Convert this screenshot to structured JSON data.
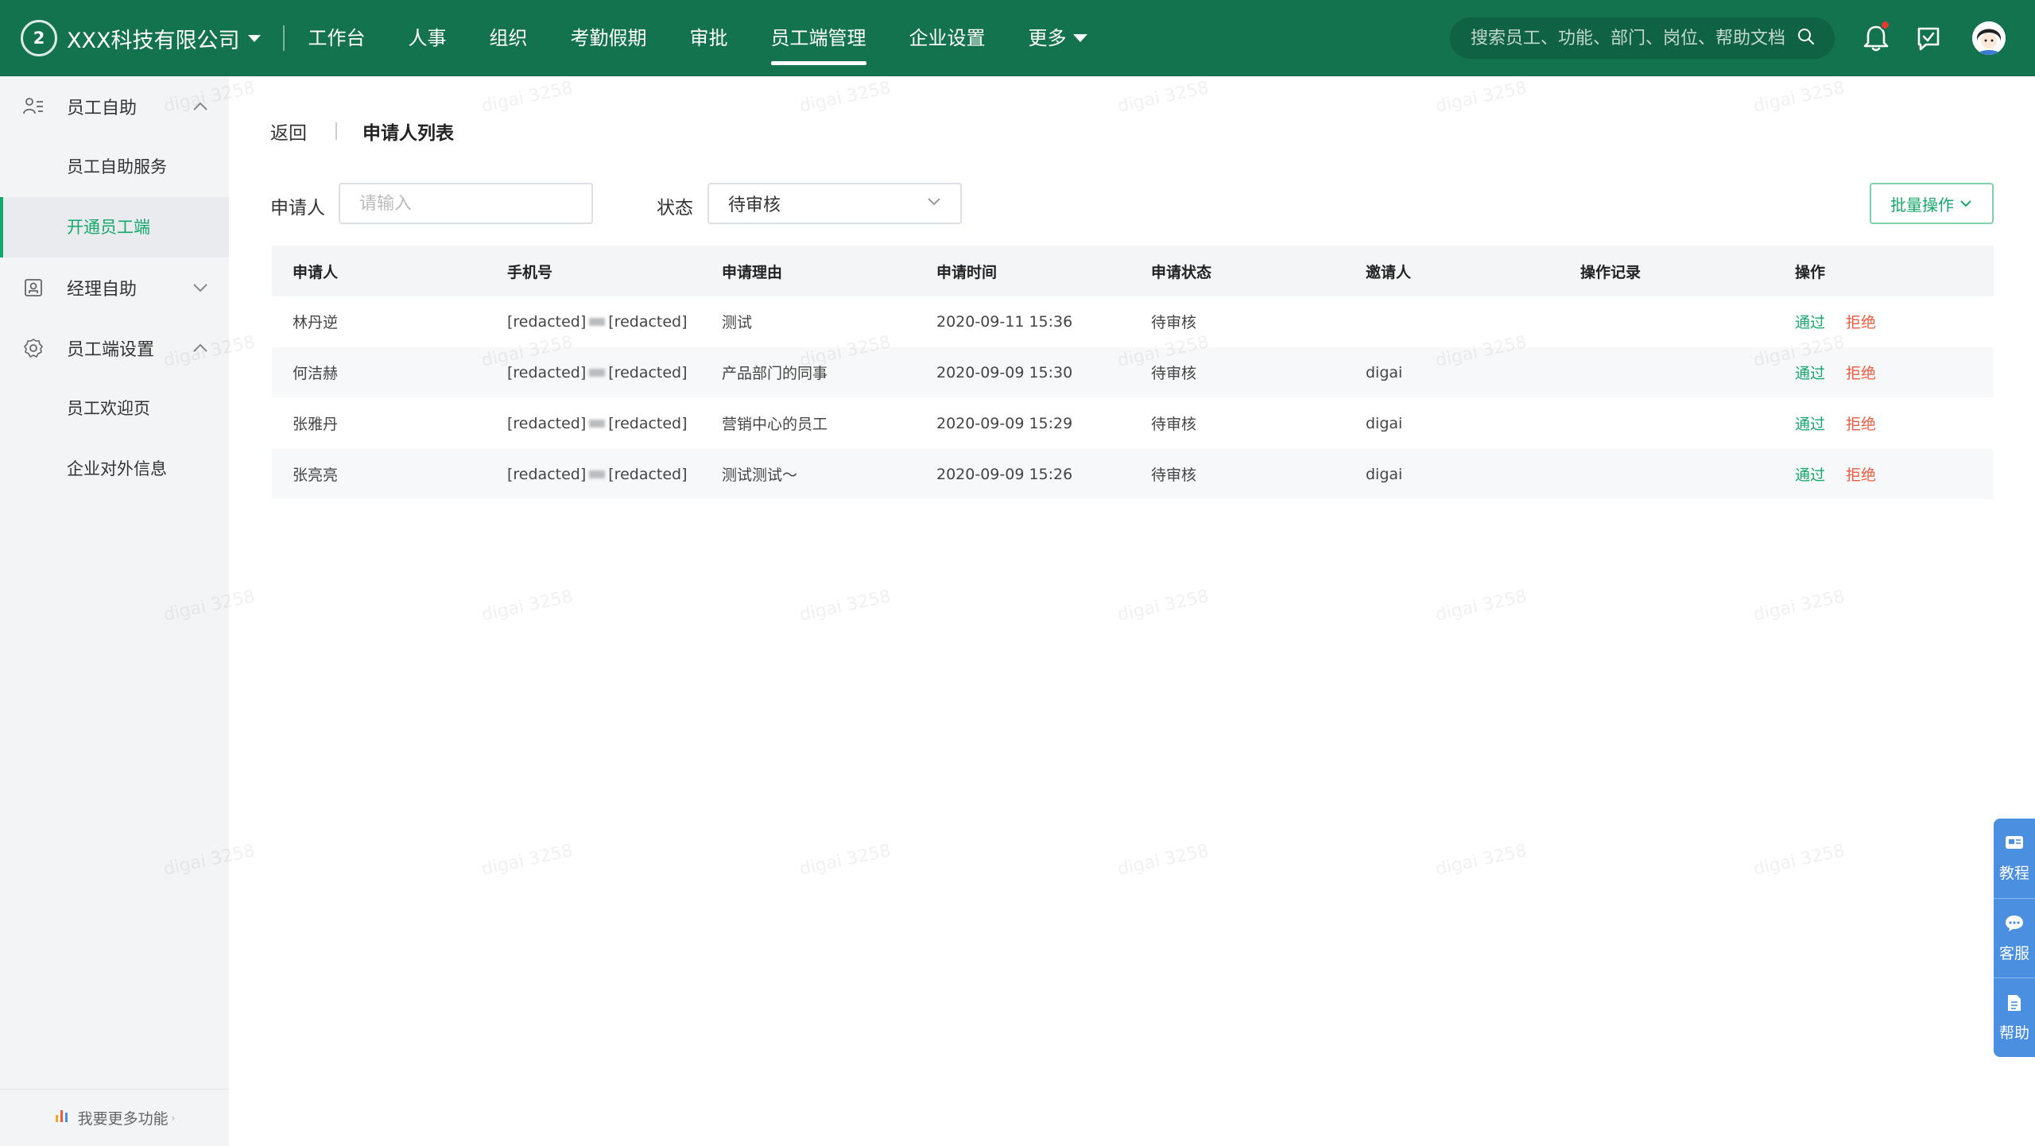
{
  "app": {
    "logo_text": "2",
    "company": "XXX科技有限公司"
  },
  "nav": {
    "items": [
      "工作台",
      "人事",
      "组织",
      "考勤假期",
      "审批",
      "员工端管理",
      "企业设置",
      "更多"
    ],
    "active_index": 5
  },
  "search": {
    "placeholder": "搜索员工、功能、部门、岗位、帮助文档"
  },
  "sidebar": {
    "groups": [
      {
        "label": "员工自助",
        "icon": "person-list-icon",
        "expanded": true
      },
      {
        "label": "经理自助",
        "icon": "badge-icon",
        "expanded": false
      },
      {
        "label": "员工端设置",
        "icon": "gear-icon",
        "expanded": true
      }
    ],
    "subitems": [
      "员工自助服务",
      "开通员工端",
      "员工欢迎页",
      "企业对外信息"
    ],
    "active_subitem": "开通员工端",
    "more_functions": "我要更多功能"
  },
  "breadcrumb": {
    "back": "返回",
    "title": "申请人列表"
  },
  "filters": {
    "applicant_label": "申请人",
    "applicant_placeholder": "请输入",
    "status_label": "状态",
    "status_value": "待审核"
  },
  "batch_button": "批量操作",
  "table": {
    "headers": [
      "申请人",
      "手机号",
      "申请理由",
      "申请时间",
      "申请状态",
      "邀请人",
      "操作记录",
      "操作"
    ],
    "rows": [
      {
        "name": "林丹逆",
        "phone_prefix": "[redacted]",
        "phone_suffix": "[redacted]",
        "reason": "测试",
        "time": "2020-09-11 15:36",
        "status": "待审核",
        "inviter": "",
        "record": ""
      },
      {
        "name": "何洁赫",
        "phone_prefix": "[redacted]",
        "phone_suffix": "[redacted]",
        "reason": "产品部门的同事",
        "time": "2020-09-09 15:30",
        "status": "待审核",
        "inviter": "digai",
        "record": ""
      },
      {
        "name": "张雅丹",
        "phone_prefix": "[redacted]",
        "phone_suffix": "[redacted]",
        "reason": "营销中心的员工",
        "time": "2020-09-09 15:29",
        "status": "待审核",
        "inviter": "digai",
        "record": ""
      },
      {
        "name": "张亮亮",
        "phone_prefix": "[redacted]",
        "phone_suffix": "[redacted]",
        "reason": "测试测试～",
        "time": "2020-09-09 15:26",
        "status": "待审核",
        "inviter": "digai",
        "record": ""
      }
    ],
    "action_pass": "通过",
    "action_reject": "拒绝"
  },
  "float_toolbar": [
    "教程",
    "客服",
    "帮助"
  ],
  "watermark_text": "digai 3258",
  "colors": {
    "topbar": "#14734f",
    "accent_green": "#14a86b",
    "reject_red": "#ef5b3f",
    "float_blue": "#4a8fe0",
    "notification_dot": "#e33b2e"
  }
}
